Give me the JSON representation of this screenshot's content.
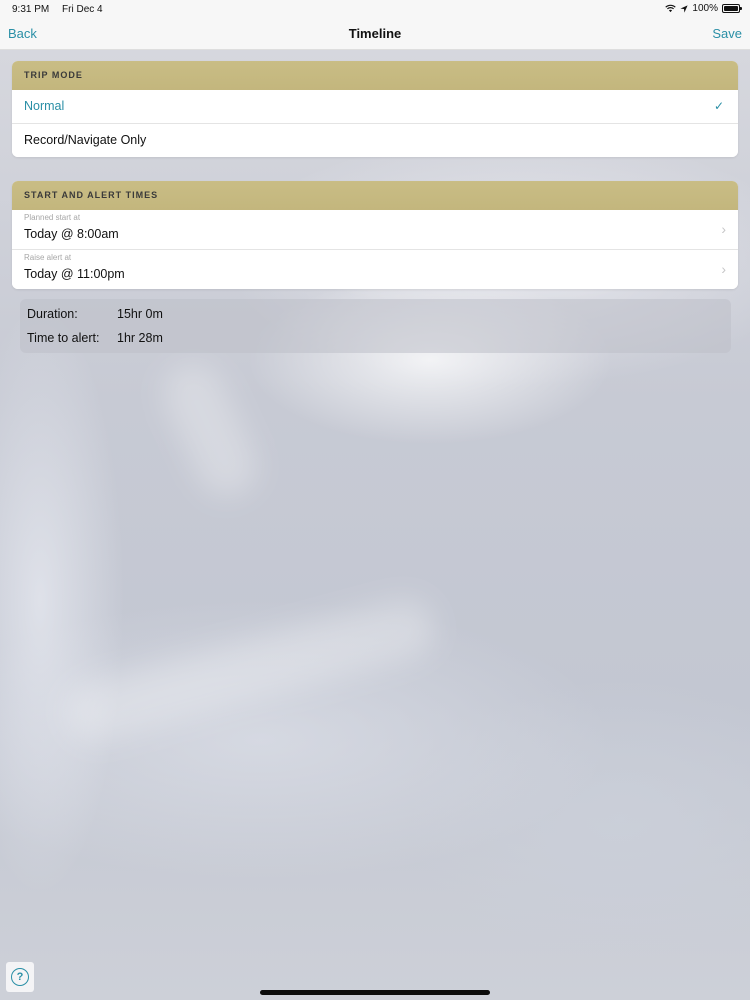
{
  "status_bar": {
    "time": "9:31 PM",
    "date": "Fri Dec 4",
    "battery_percent": "100%",
    "battery_level": 1.0
  },
  "nav": {
    "back_label": "Back",
    "title": "Timeline",
    "save_label": "Save"
  },
  "trip_mode": {
    "header": "TRIP MODE",
    "options": [
      {
        "label": "Normal",
        "selected": true
      },
      {
        "label": "Record/Navigate Only",
        "selected": false
      }
    ],
    "check_glyph": "✓"
  },
  "times": {
    "header": "START AND ALERT TIMES",
    "planned_start_label": "Planned start at",
    "planned_start_value": "Today @ 8:00am",
    "raise_alert_label": "Raise alert at",
    "raise_alert_value": "Today @ 11:00pm",
    "chevron_glyph": "›"
  },
  "summary": {
    "duration_label": "Duration:",
    "duration_value": "15hr 0m",
    "time_to_alert_label": "Time to alert:",
    "time_to_alert_value": "1hr 28m"
  },
  "help": {
    "glyph": "?",
    "icon": "help-circle-icon"
  },
  "colors": {
    "accent": "#2a8fa6",
    "section_header": "#c6b980"
  }
}
